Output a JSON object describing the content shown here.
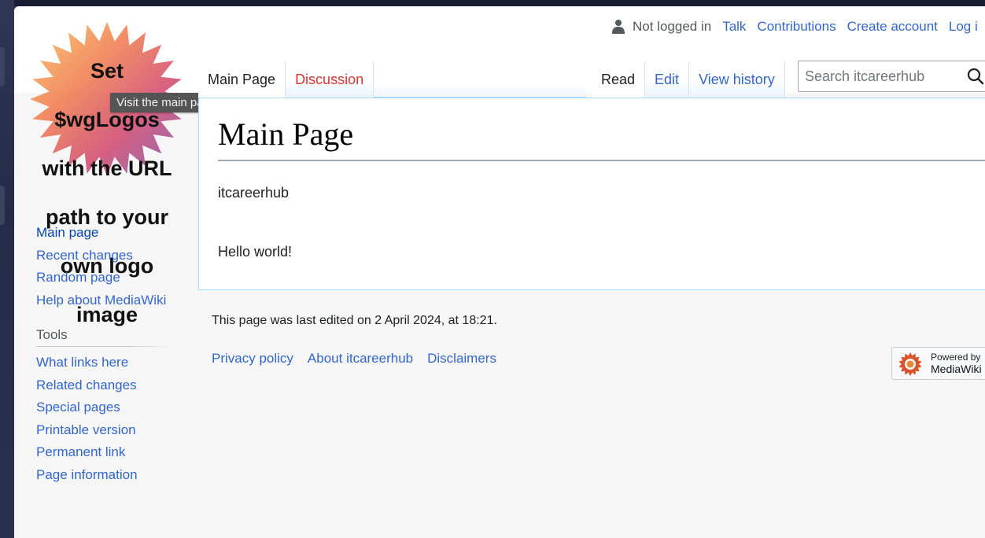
{
  "logo": {
    "text": "Set $wgLogos with the URL path to your own logo image",
    "lines": [
      "Set",
      "$wgLogos",
      "with the URL",
      "path to your",
      "own logo",
      "image"
    ]
  },
  "tooltip": "Visit the main page",
  "personal_tools": {
    "status": "Not logged in",
    "links": [
      "Talk",
      "Contributions",
      "Create account",
      "Log i"
    ]
  },
  "tabs": {
    "left": [
      {
        "label": "Main Page",
        "selected": true
      },
      {
        "label": "Discussion",
        "selected": false
      }
    ],
    "right": [
      {
        "label": "Read",
        "selected": true
      },
      {
        "label": "Edit",
        "selected": false
      },
      {
        "label": "View history",
        "selected": false
      }
    ]
  },
  "search": {
    "placeholder": "Search itcareerhub"
  },
  "content": {
    "title": "Main Page",
    "paragraph1": "itcareerhub",
    "paragraph2": "Hello world!"
  },
  "sidebar": {
    "navigation": [
      "Main page",
      "Recent changes",
      "Random page",
      "Help about MediaWiki"
    ],
    "tools_heading": "Tools",
    "tools": [
      "What links here",
      "Related changes",
      "Special pages",
      "Printable version",
      "Permanent link",
      "Page information"
    ]
  },
  "footer": {
    "last_edited": "This page was last edited on 2 April 2024, at 18:21.",
    "links": [
      "Privacy policy",
      "About itcareerhub",
      "Disclaimers"
    ],
    "powered_by_line1": "Powered by",
    "powered_by_line2": "MediaWiki"
  },
  "colors": {
    "link": "#3366cc",
    "new_link": "#dd3333",
    "page_bg": "#f6f6f6",
    "border": "#a7d7f9"
  },
  "icons": [
    "user-icon",
    "search-icon",
    "mediawiki-logo-icon",
    "site-logo"
  ]
}
